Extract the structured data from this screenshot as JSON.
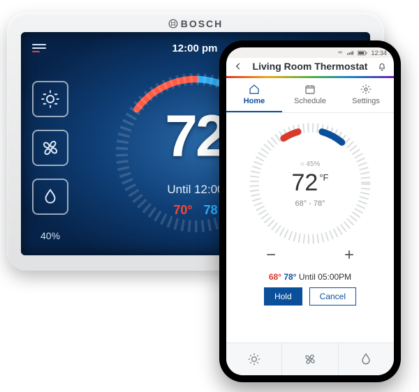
{
  "device": {
    "brand": "BOSCH",
    "time": "12:00 pm",
    "current_temp": "72",
    "hold_until": "Until 12:00",
    "heat_setpoint": "70°",
    "cool_setpoint": "78",
    "humidity": "40%"
  },
  "phone": {
    "status_time": "12:34",
    "title": "Living Room Thermostat",
    "tabs": {
      "home": "Home",
      "schedule": "Schedule",
      "settings": "Settings"
    },
    "humidity": "45%",
    "humidity_prefix": "○",
    "temp": "72",
    "temp_unit": "°F",
    "range": "68° - 78°",
    "schedule": {
      "heat": "68°",
      "cool": "78°",
      "until": "Until 05:00PM"
    },
    "buttons": {
      "hold": "Hold",
      "cancel": "Cancel"
    },
    "minus": "−",
    "plus": "+"
  }
}
